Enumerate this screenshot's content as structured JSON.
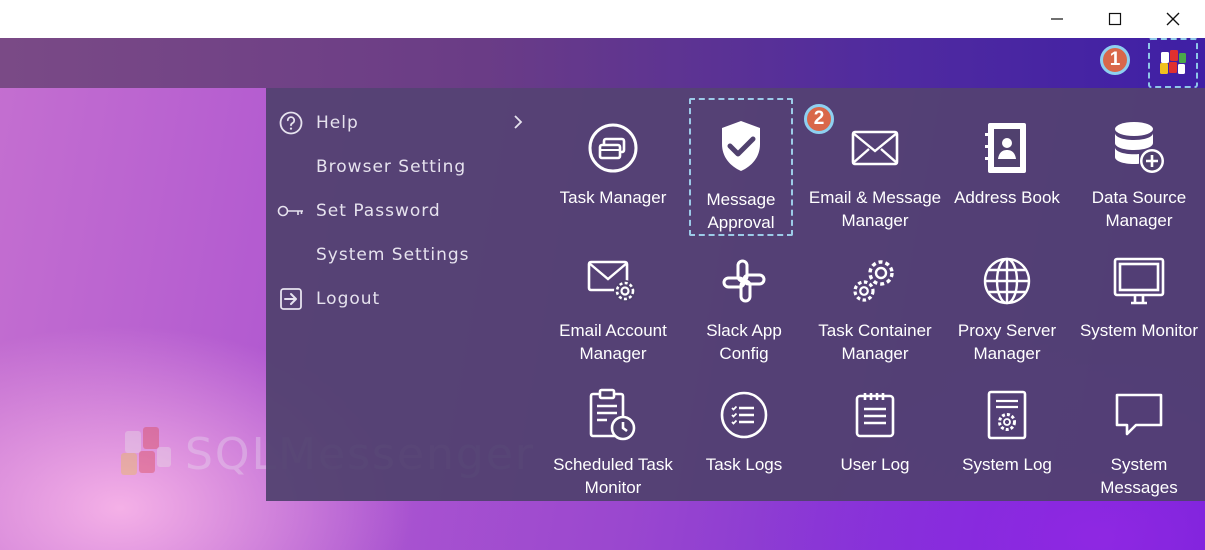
{
  "window_controls": {
    "minimize_icon": "minimize-icon",
    "maximize_icon": "maximize-icon",
    "close_icon": "close-icon"
  },
  "background_logo": {
    "text": "SQLMessenger"
  },
  "annotations": {
    "step1": "1",
    "step2": "2"
  },
  "menu": {
    "items": [
      {
        "label": "Help",
        "icon": "help-icon",
        "has_submenu": true
      },
      {
        "label": "Browser Setting",
        "icon": ""
      },
      {
        "label": "Set Password",
        "icon": "key-icon"
      },
      {
        "label": "System Settings",
        "icon": ""
      },
      {
        "label": "Logout",
        "icon": "logout-icon"
      }
    ]
  },
  "tiles": [
    {
      "label": "Task Manager",
      "icon": "task-manager-icon"
    },
    {
      "label": "Message\nApproval",
      "icon": "shield-check-icon",
      "selected": true
    },
    {
      "label": "Email & Message\nManager",
      "icon": "envelope-icon"
    },
    {
      "label": "Address Book",
      "icon": "address-book-icon"
    },
    {
      "label": "Data Source\nManager",
      "icon": "database-add-icon"
    },
    {
      "label": "Email Account\nManager",
      "icon": "email-gear-icon"
    },
    {
      "label": "Slack App\nConfig",
      "icon": "slack-icon"
    },
    {
      "label": "Task Container\nManager",
      "icon": "gears-icon"
    },
    {
      "label": "Proxy Server\nManager",
      "icon": "globe-icon"
    },
    {
      "label": "System Monitor",
      "icon": "monitor-icon"
    },
    {
      "label": "Scheduled Task\nMonitor",
      "icon": "clipboard-clock-icon"
    },
    {
      "label": "Task Logs",
      "icon": "list-circle-icon"
    },
    {
      "label": "User Log",
      "icon": "notepad-icon"
    },
    {
      "label": "System Log",
      "icon": "document-gear-icon"
    },
    {
      "label": "System\nMessages",
      "icon": "speech-bubble-icon"
    }
  ],
  "colors": {
    "badge": "#d9674a",
    "badge_border": "#8ed0f0",
    "panel": "#50416e",
    "selection_dash": "#9ccbe8"
  }
}
